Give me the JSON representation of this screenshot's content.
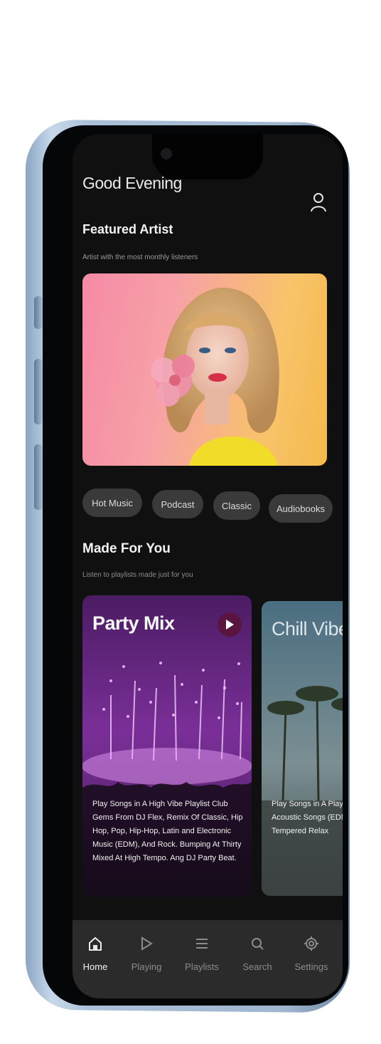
{
  "greeting": "Good Evening",
  "featured": {
    "title": "Featured Artist",
    "subtitle": "Artist with the most monthly listeners"
  },
  "chips": [
    "Hot Music",
    "Podcast",
    "Classic",
    "Audiobooks"
  ],
  "made_for_you": {
    "title": "Made For You",
    "subtitle": "Listen to playlists made just for you",
    "cards": [
      {
        "title": "Party Mix",
        "description": "Play Songs in A High Vibe Playlist Club Gems From DJ Flex, Remix Of Classic, Hip Hop, Pop, Hip-Hop, Latin and Electronic Music (EDM), And Rock. Bumping At Thirty Mixed At High Tempo. Ang DJ Party Beat."
      },
      {
        "title": "Chill Vibes",
        "description": "Play Songs in A Playlist From Chilled Relaxing Acoustic Songs (EDM), Pop, Indie, Lofi. High Tempered Relax"
      }
    ]
  },
  "tabs": [
    {
      "label": "Home",
      "icon": "home-icon",
      "active": true
    },
    {
      "label": "Playing",
      "icon": "play-icon",
      "active": false
    },
    {
      "label": "Playlists",
      "icon": "list-icon",
      "active": false
    },
    {
      "label": "Search",
      "icon": "search-icon",
      "active": false
    },
    {
      "label": "Settings",
      "icon": "gear-icon",
      "active": false
    }
  ],
  "colors": {
    "screen_bg": "#101010",
    "chip_bg": "#3a3a3a",
    "tabbar_bg": "#2b2b2b",
    "party_accent": "#6a2b8a",
    "frame_blue": "#9fb6cf"
  }
}
